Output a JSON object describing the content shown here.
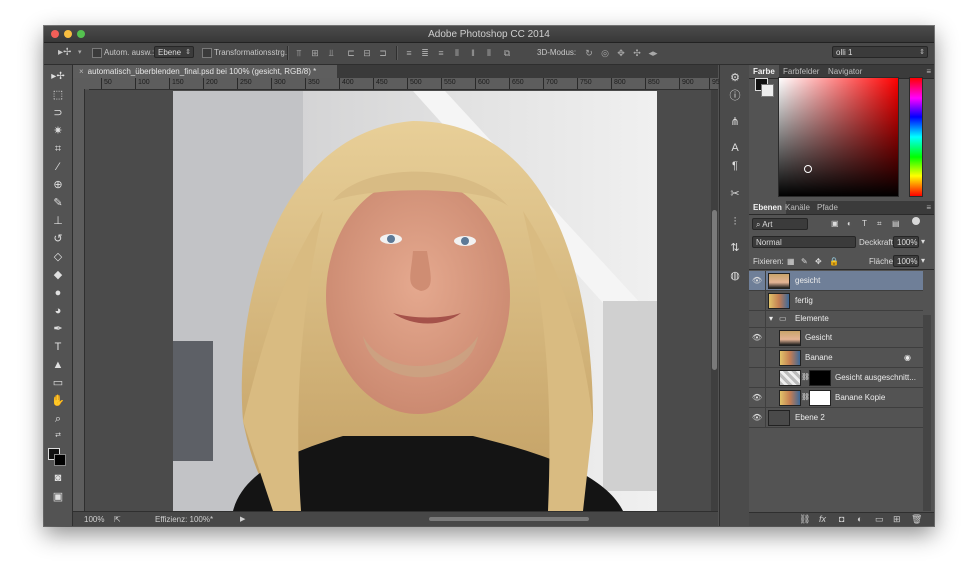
{
  "window": {
    "title": "Adobe Photoshop CC 2014"
  },
  "options": {
    "tool_glyph": "▸✢",
    "auto_select_label": "Autom. ausw.:",
    "auto_select_target": "Ebene",
    "transform_label": "Transformationsstrg.",
    "mode3d_label": "3D-Modus:",
    "workspace": "olli 1"
  },
  "document": {
    "tab_title": "automatisch_überblenden_final.psd bei 100% (gesicht, RGB/8) *"
  },
  "ruler": {
    "top_ticks": [
      "50",
      "100",
      "150",
      "200",
      "250",
      "300",
      "350",
      "400",
      "450",
      "500",
      "550",
      "600",
      "650",
      "700",
      "750",
      "800",
      "850",
      "900",
      "95"
    ]
  },
  "status": {
    "zoom": "100%",
    "efficiency": "Effizienz: 100%*"
  },
  "color_panel": {
    "tabs": [
      "Farbe",
      "Farbfelder",
      "Navigator"
    ]
  },
  "layers_panel": {
    "tabs": [
      "Ebenen",
      "Kanäle",
      "Pfade"
    ],
    "filter_kind": "Art",
    "blend_mode": "Normal",
    "opacity_label": "Deckkraft:",
    "opacity_value": "100%",
    "lock_label": "Fixieren:",
    "fill_label": "Fläche:",
    "fill_value": "100%",
    "layers": [
      {
        "name": "gesicht",
        "visible": true,
        "selected": true
      },
      {
        "name": "fertig",
        "visible": false,
        "selected": false
      },
      {
        "name": "Elemente",
        "visible": false,
        "group": true
      },
      {
        "name": "Gesicht",
        "visible": true
      },
      {
        "name": "Banane",
        "visible": false
      },
      {
        "name": "Gesicht ausgeschnitt...",
        "visible": false
      },
      {
        "name": "Banane Kopie",
        "visible": true
      },
      {
        "name": "Ebene 2",
        "visible": true
      }
    ]
  }
}
